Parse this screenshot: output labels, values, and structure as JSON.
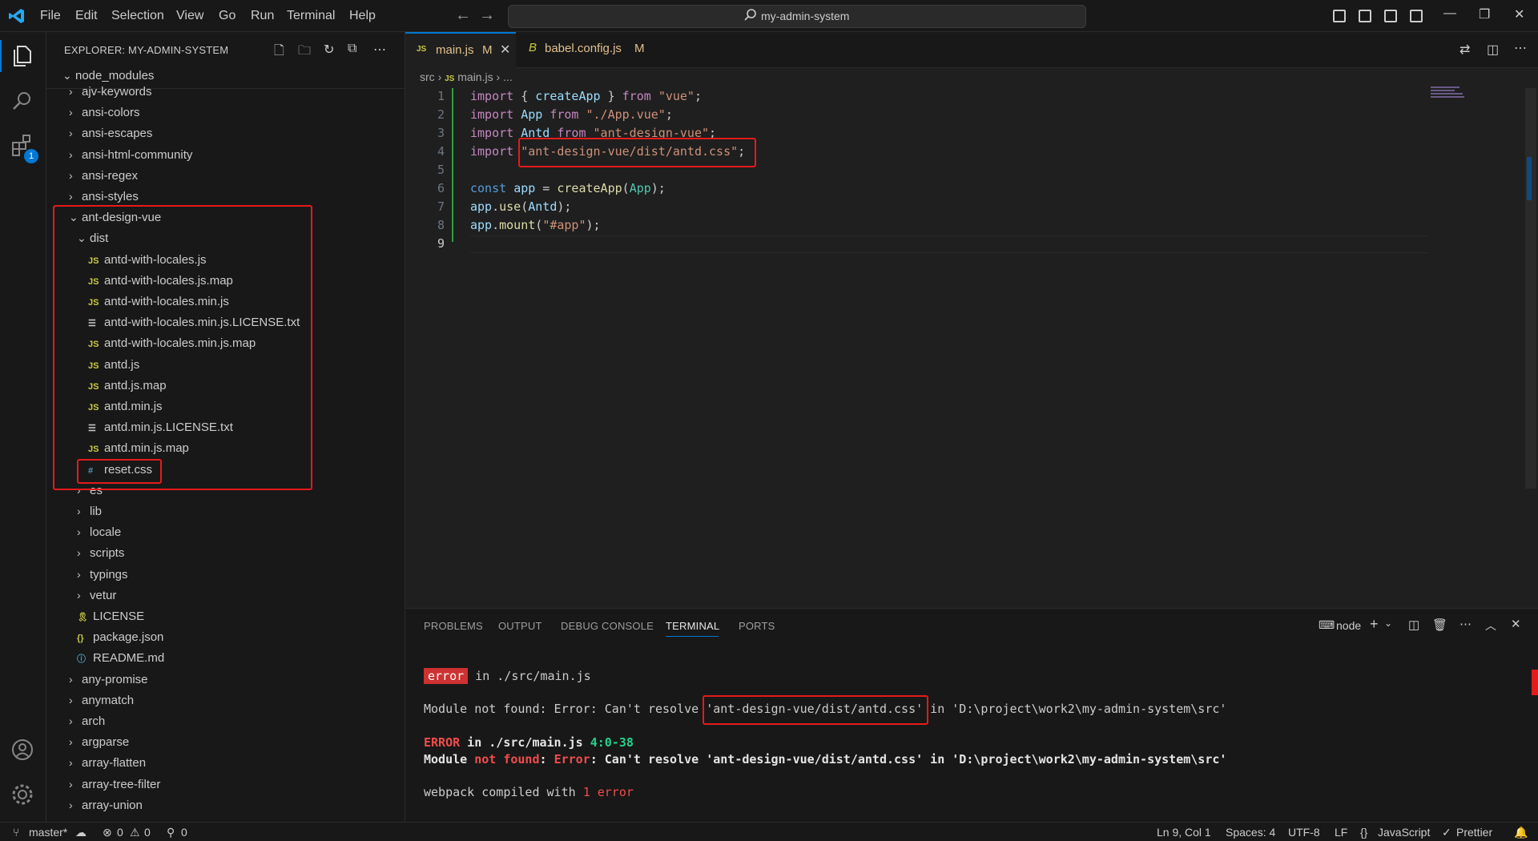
{
  "menu": [
    "File",
    "Edit",
    "Selection",
    "View",
    "Go",
    "Run",
    "Terminal",
    "Help"
  ],
  "search": {
    "text": "my-admin-system"
  },
  "explorer": {
    "title": "EXPLORER: MY-ADMIN-SYSTEM",
    "root": "node_modules",
    "items": [
      {
        "label": "ajv-keywords",
        "type": "folder"
      },
      {
        "label": "ansi-colors",
        "type": "folder"
      },
      {
        "label": "ansi-escapes",
        "type": "folder"
      },
      {
        "label": "ansi-html-community",
        "type": "folder"
      },
      {
        "label": "ansi-regex",
        "type": "folder"
      },
      {
        "label": "ansi-styles",
        "type": "folder"
      },
      {
        "label": "ant-design-vue",
        "type": "folder-open"
      },
      {
        "label": "dist",
        "type": "folder-open"
      },
      {
        "label": "antd-with-locales.js",
        "type": "js"
      },
      {
        "label": "antd-with-locales.js.map",
        "type": "js"
      },
      {
        "label": "antd-with-locales.min.js",
        "type": "js"
      },
      {
        "label": "antd-with-locales.min.js.LICENSE.txt",
        "type": "txt"
      },
      {
        "label": "antd-with-locales.min.js.map",
        "type": "js"
      },
      {
        "label": "antd.js",
        "type": "js"
      },
      {
        "label": "antd.js.map",
        "type": "js"
      },
      {
        "label": "antd.min.js",
        "type": "js"
      },
      {
        "label": "antd.min.js.LICENSE.txt",
        "type": "txt"
      },
      {
        "label": "antd.min.js.map",
        "type": "js"
      },
      {
        "label": "reset.css",
        "type": "css"
      },
      {
        "label": "es",
        "type": "folder"
      },
      {
        "label": "lib",
        "type": "folder"
      },
      {
        "label": "locale",
        "type": "folder"
      },
      {
        "label": "scripts",
        "type": "folder"
      },
      {
        "label": "typings",
        "type": "folder"
      },
      {
        "label": "vetur",
        "type": "folder"
      },
      {
        "label": "LICENSE",
        "type": "license"
      },
      {
        "label": "package.json",
        "type": "json"
      },
      {
        "label": "README.md",
        "type": "info"
      },
      {
        "label": "any-promise",
        "type": "folder"
      },
      {
        "label": "anymatch",
        "type": "folder"
      },
      {
        "label": "arch",
        "type": "folder"
      },
      {
        "label": "argparse",
        "type": "folder"
      },
      {
        "label": "array-flatten",
        "type": "folder"
      },
      {
        "label": "array-tree-filter",
        "type": "folder"
      },
      {
        "label": "array-union",
        "type": "folder"
      }
    ]
  },
  "tabs": [
    {
      "icon": "JS",
      "label": "main.js",
      "badge": "M"
    },
    {
      "icon": "B",
      "label": "babel.config.js",
      "badge": "M"
    }
  ],
  "breadcrumb": {
    "src": "src",
    "file": "main.js",
    "rest": "..."
  },
  "code": {
    "line_numbers": [
      "1",
      "2",
      "3",
      "4",
      "5",
      "6",
      "7",
      "8",
      "9"
    ],
    "l1": {
      "a": "import",
      "b": " { ",
      "c": "createApp",
      "d": " } ",
      "e": "from",
      "f": " ",
      "g": "\"vue\"",
      "h": ";"
    },
    "l2": {
      "a": "import",
      "b": " ",
      "c": "App",
      "d": " ",
      "e": "from",
      "f": " ",
      "g": "\"./App.vue\"",
      "h": ";"
    },
    "l3": {
      "a": "import",
      "b": " ",
      "c": "Antd",
      "d": " ",
      "e": "from",
      "f": " ",
      "g": "\"ant-design-vue\"",
      "h": ";"
    },
    "l4": {
      "a": "import",
      "b": " ",
      "g": "\"ant-design-vue/dist/antd.css\"",
      "h": ";"
    },
    "l6": {
      "a": "const",
      "b": " ",
      "c": "app",
      "d": " = ",
      "e": "createApp",
      "f": "(",
      "g": "App",
      "h": ");"
    },
    "l7": {
      "a": "app",
      "b": ".",
      "c": "use",
      "d": "(",
      "e": "Antd",
      "f": ");"
    },
    "l8": {
      "a": "app",
      "b": ".",
      "c": "mount",
      "d": "(",
      "e": "\"#app\"",
      "f": ");"
    }
  },
  "panel": {
    "tabs": [
      "PROBLEMS",
      "OUTPUT",
      "DEBUG CONSOLE",
      "TERMINAL",
      "PORTS"
    ],
    "terminal_name": "node",
    "lines": {
      "badge": "error",
      "badge_rest": " in ./src/main.js",
      "mnf_a": "Module not found: Error: Can't resolve ",
      "mnf_b": "'ant-design-vue/dist/antd.css'",
      "mnf_c": " in 'D:\\project\\work2\\my-admin-system\\src'",
      "err_a": "ERROR",
      "err_b": " in ./src/main.js ",
      "err_c": "4:0-38",
      "mod_a": "Module ",
      "mod_b": "not found",
      "mod_c": ": ",
      "mod_d": "Error",
      "mod_e": ": Can't resolve 'ant-design-vue/dist/antd.css' in 'D:\\project\\work2\\my-admin-system\\src'",
      "wp_a": "webpack compiled with ",
      "wp_b": "1 error"
    }
  },
  "status": {
    "branch": "master*",
    "errors": "0",
    "warnings": "0",
    "ports": "0",
    "position": "Ln 9, Col 1",
    "spaces": "Spaces: 4",
    "encoding": "UTF-8",
    "eol": "LF",
    "language": "JavaScript",
    "formatter": "Prettier"
  },
  "badges": {
    "extensions": "1"
  },
  "colors": {
    "accent": "#0078d4",
    "error": "#e51a1a"
  }
}
